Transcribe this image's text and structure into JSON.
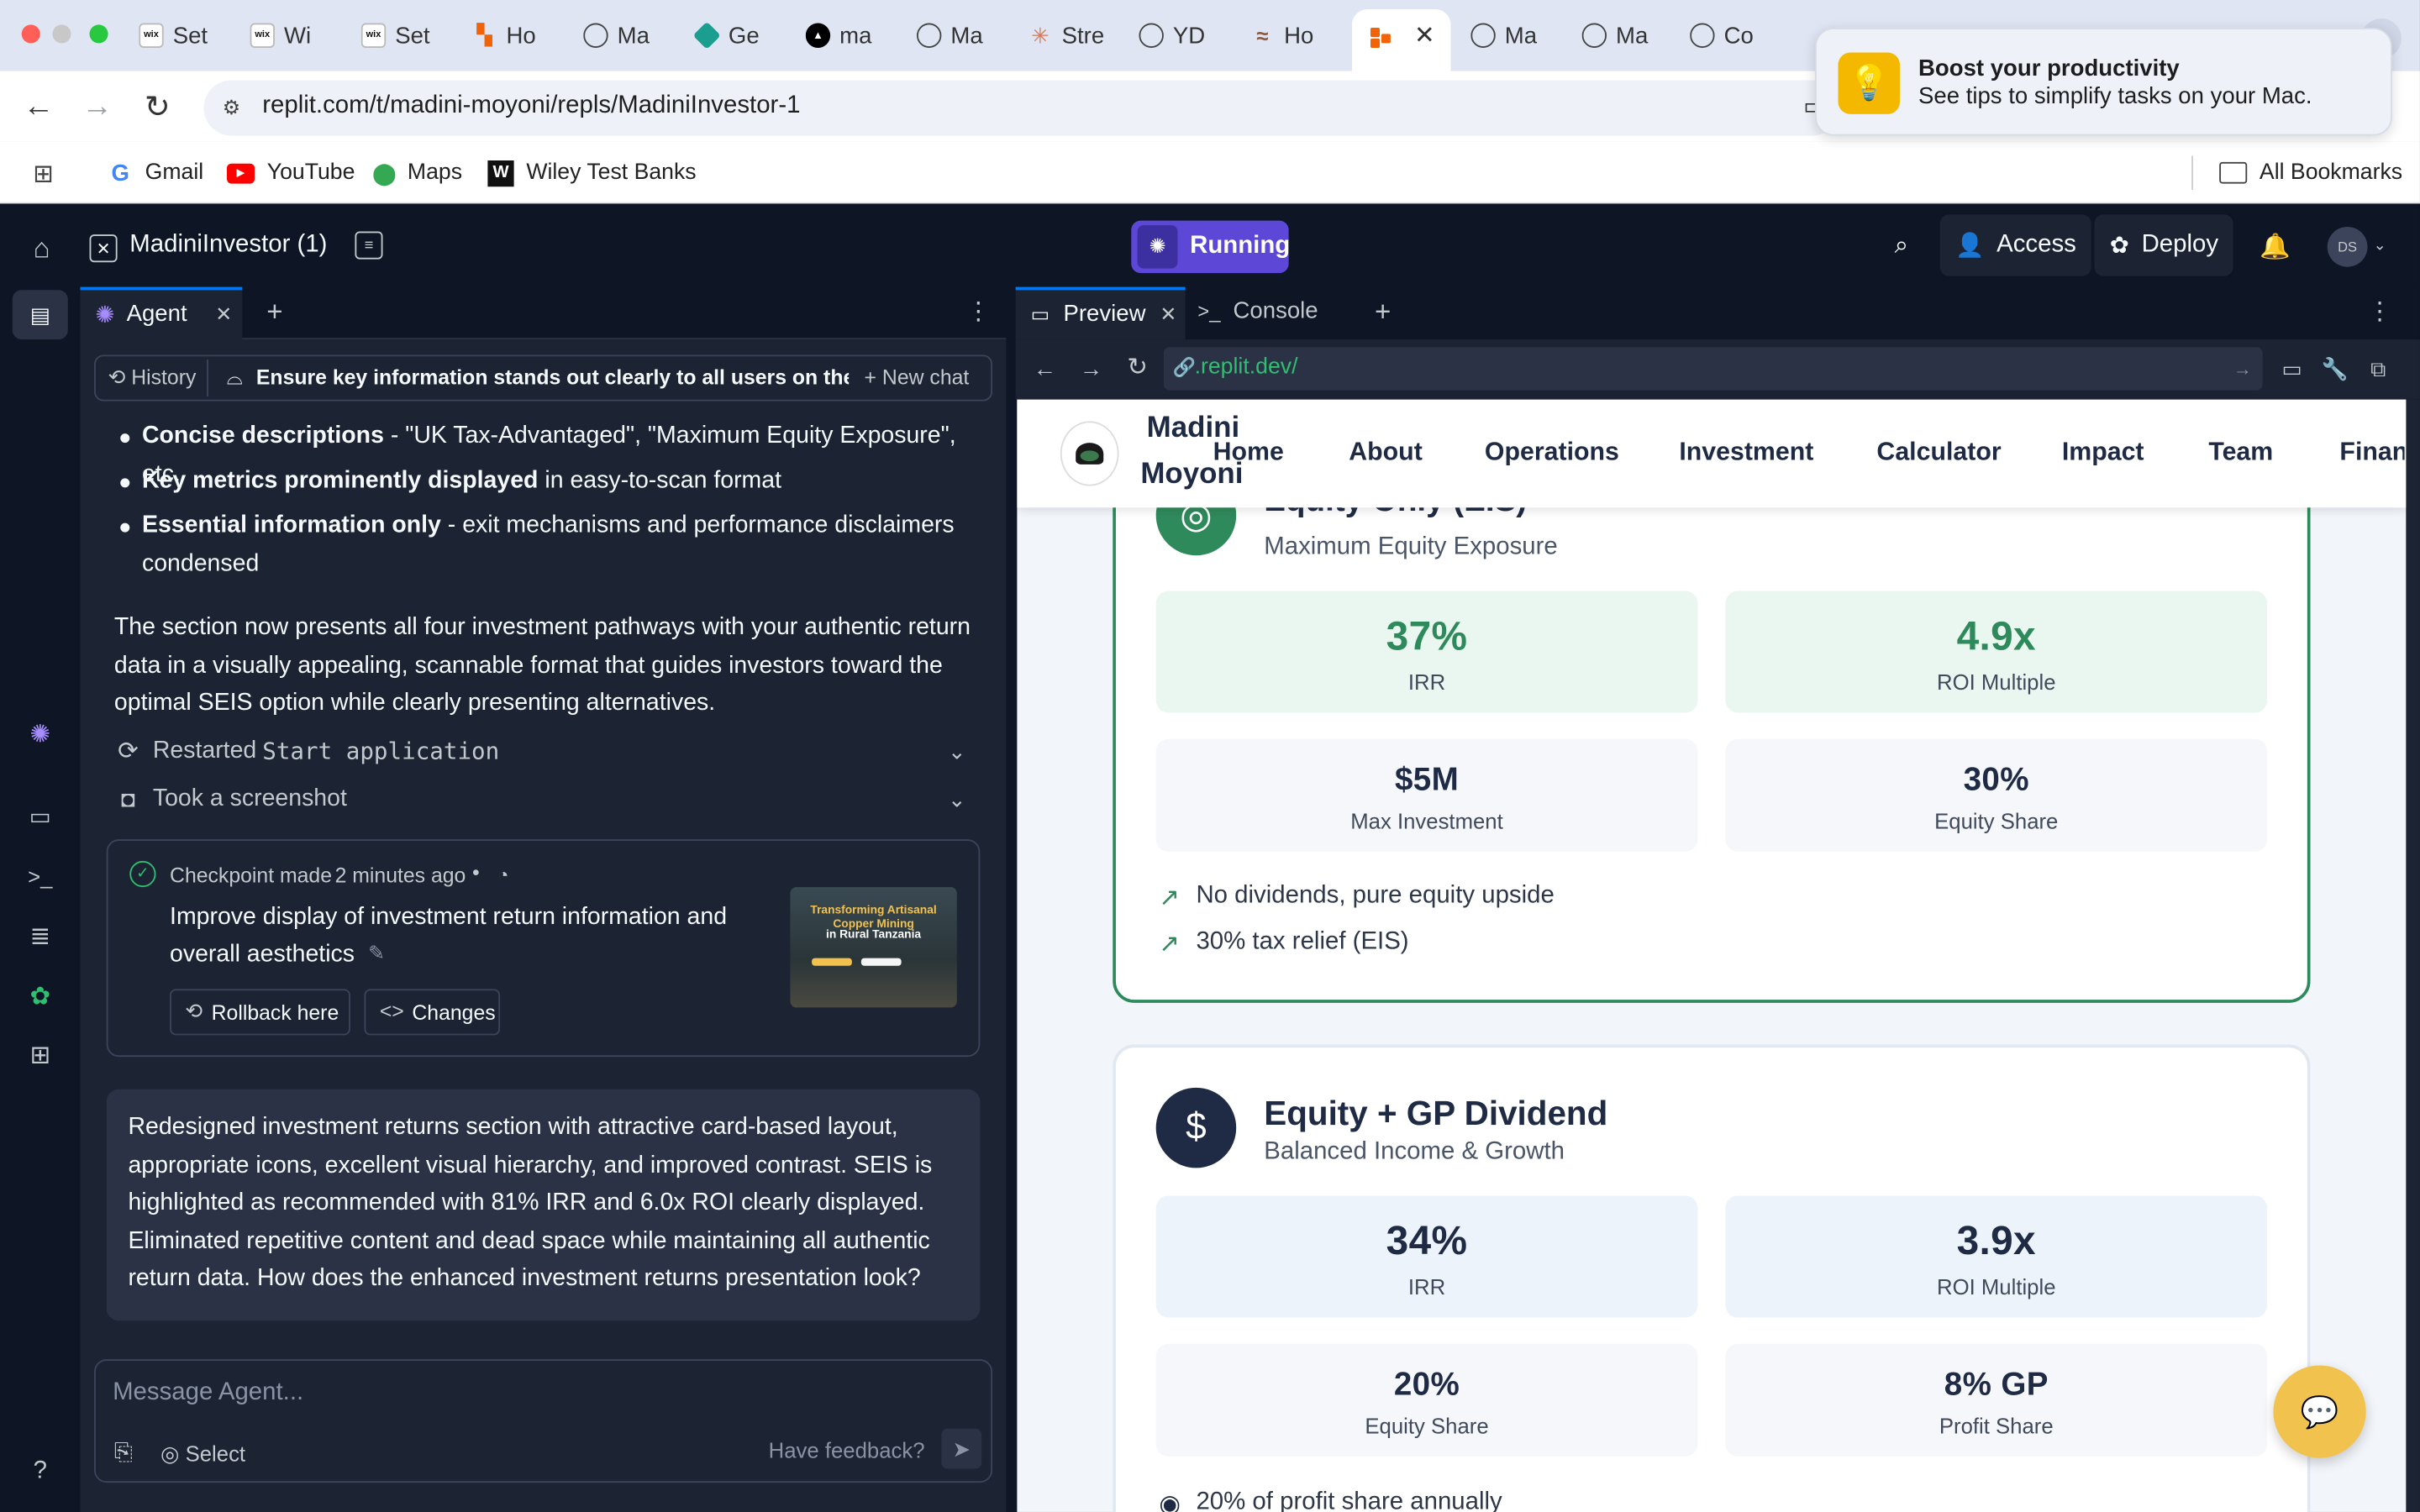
{
  "browser": {
    "tabs": [
      {
        "label": "Set",
        "icon": "wix-icon"
      },
      {
        "label": "Wi",
        "icon": "wix-icon"
      },
      {
        "label": "Set",
        "icon": "wix-icon"
      },
      {
        "label": "Ho",
        "icon": "replit-icon"
      },
      {
        "label": "Ma",
        "icon": "globe-icon"
      },
      {
        "label": "Ge",
        "icon": "gem-icon"
      },
      {
        "label": "ma",
        "icon": "triangle-icon"
      },
      {
        "label": "Ma",
        "icon": "globe-icon"
      },
      {
        "label": "Stre",
        "icon": "claude-icon"
      },
      {
        "label": "YD",
        "icon": "globe-icon"
      },
      {
        "label": "Ho",
        "icon": "wave-icon"
      },
      {
        "label": "",
        "icon": "replit-icon"
      },
      {
        "label": "Ma",
        "icon": "globe-icon"
      },
      {
        "label": "Ma",
        "icon": "globe-icon"
      },
      {
        "label": "Co",
        "icon": "globe-icon"
      }
    ],
    "url": "replit.com/t/madini-moyoni/repls/MadiniInvestor-1",
    "bookmarks": [
      "Gmail",
      "YouTube",
      "Maps",
      "Wiley Test Banks"
    ],
    "all_bookmarks": "All Bookmarks"
  },
  "notification": {
    "title": "Boost your productivity",
    "body": "See tips to simplify tasks on your Mac."
  },
  "replit": {
    "project": "MadiniInvestor (1)",
    "run_status": "Running",
    "access": "Access",
    "deploy": "Deploy",
    "avatar": "DS"
  },
  "agent": {
    "tab": "Agent",
    "history": "History",
    "thread_title": "Ensure key information stands out clearly to all users on the pl...",
    "new_chat": "New chat",
    "bullets": [
      {
        "bold": "Concise descriptions",
        "rest": " - \"UK Tax-Advantaged\", \"Maximum Equity Exposure\", etc."
      },
      {
        "bold": "Key metrics prominently displayed",
        "rest": " in easy-to-scan format"
      },
      {
        "bold": "Essential information only",
        "rest": " - exit mechanisms and performance disclaimers condensed"
      }
    ],
    "summary": "The section now presents all four investment pathways with your authentic return data in a visually appealing, scannable format that guides investors toward the optimal SEIS option while clearly presenting alternatives.",
    "action1_prefix": "Restarted",
    "action1_code": "Start application",
    "action2": "Took a screenshot",
    "checkpoint": {
      "label": "Checkpoint made",
      "time": "2 minutes ago",
      "title": "Improve display of investment return information and overall aesthetics",
      "rollback": "Rollback here",
      "changes": "Changes",
      "thumb_title": "Transforming Artisanal Copper Mining",
      "thumb_sub": "in Rural Tanzania"
    },
    "message": "Redesigned investment returns section with attractive card-based layout, appropriate icons, excellent visual hierarchy, and improved contrast. SEIS is highlighted as recommended with 81% IRR and 6.0x ROI clearly displayed. Eliminated repetitive content and dead space while maintaining all authentic return data. How does the enhanced investment returns presentation look?",
    "input_placeholder": "Message Agent...",
    "select": "Select",
    "feedback": "Have feedback?"
  },
  "preview": {
    "tab_preview": "Preview",
    "tab_console": "Console",
    "url": ".replit.dev/",
    "site": {
      "brand_line1": "Madini",
      "brand_line2": "Moyoni",
      "nav": [
        "Home",
        "About",
        "Operations",
        "Investment",
        "Calculator",
        "Impact",
        "Team",
        "Financ"
      ]
    },
    "card1": {
      "title": "Equity Only (EIS)",
      "subtitle": "Maximum Equity Exposure",
      "metrics": [
        {
          "value": "37%",
          "label": "IRR"
        },
        {
          "value": "4.9x",
          "label": "ROI Multiple"
        },
        {
          "value": "$5M",
          "label": "Max Investment"
        },
        {
          "value": "30%",
          "label": "Equity Share"
        }
      ],
      "features": [
        "No dividends, pure equity upside",
        "30% tax relief (EIS)"
      ]
    },
    "card2": {
      "title": "Equity + GP Dividend",
      "subtitle": "Balanced Income & Growth",
      "metrics": [
        {
          "value": "34%",
          "label": "IRR"
        },
        {
          "value": "3.9x",
          "label": "ROI Multiple"
        },
        {
          "value": "20%",
          "label": "Equity Share"
        },
        {
          "value": "8% GP",
          "label": "Profit Share"
        }
      ],
      "feature_partial": "20% of profit share annually"
    }
  },
  "colors": {
    "accent_green": "#2f8a5b",
    "accent_navy": "#1f2b44",
    "replit_running": "#5c47d6",
    "chat_bubble": "#f1c34e"
  }
}
